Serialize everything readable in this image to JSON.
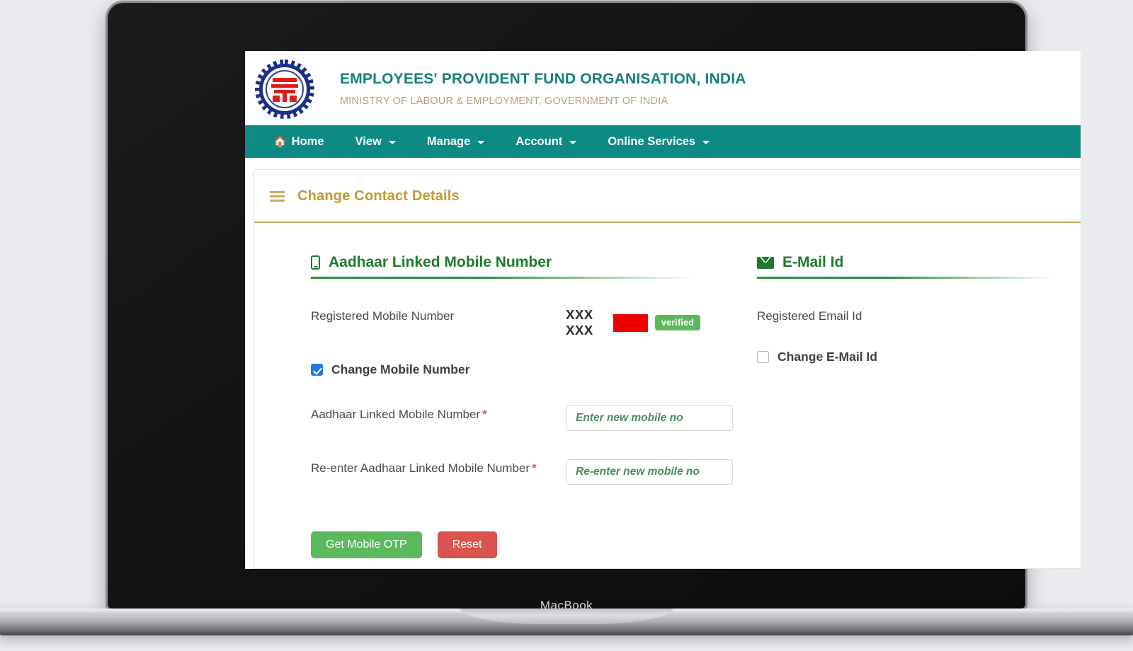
{
  "device": {
    "wordmark": "MacBook"
  },
  "site": {
    "logo_name": "epfo-emblem",
    "org_title": "EMPLOYEES' PROVIDENT FUND ORGANISATION, INDIA",
    "ministry_subtitle": "MINISTRY OF LABOUR & EMPLOYMENT, GOVERNMENT OF INDIA",
    "nav": [
      {
        "label": "Home",
        "icon": "home-icon",
        "has_caret": false
      },
      {
        "label": "View",
        "icon": "",
        "has_caret": true
      },
      {
        "label": "Manage",
        "icon": "",
        "has_caret": true
      },
      {
        "label": "Account",
        "icon": "",
        "has_caret": true
      },
      {
        "label": "Online Services",
        "icon": "",
        "has_caret": true
      }
    ]
  },
  "card": {
    "menu_icon": "hamburger-icon",
    "title": "Change Contact Details"
  },
  "mobile_section": {
    "icon": "mobile-phone-icon",
    "heading": "Aadhaar Linked Mobile Number",
    "registered_label": "Registered Mobile Number",
    "registered_value": "XXX XXX",
    "redacted": true,
    "verified_badge": "verified",
    "change_checkbox_label": "Change Mobile Number",
    "change_checkbox_checked": true,
    "new_number_label": "Aadhaar Linked Mobile Number",
    "new_number_required": "*",
    "new_number_placeholder": "Enter new mobile no",
    "new_number_value": "",
    "reenter_label": "Re-enter Aadhaar Linked Mobile Number",
    "reenter_required": "*",
    "reenter_placeholder": "Re-enter new mobile no",
    "reenter_value": ""
  },
  "email_section": {
    "icon": "envelope-icon",
    "heading": "E-Mail Id",
    "registered_label": "Registered Email Id",
    "change_checkbox_label": "Change E-Mail Id",
    "change_checkbox_checked": false
  },
  "actions": {
    "get_otp_label": "Get Mobile OTP",
    "reset_label": "Reset"
  },
  "colors": {
    "nav_teal": "#0d8a84",
    "org_title_teal": "#17807a",
    "ministry_tan": "#b8a177",
    "card_title_gold": "#bf9a31",
    "card_rule_gold": "#c9a95e",
    "section_green": "#1d7a2e",
    "underline_green": "#2a9440",
    "verified_green": "#5cb85c",
    "reset_red": "#d9534f",
    "redaction_red": "#ef0000",
    "checkbox_blue": "#2278e6",
    "required_star_red": "#e2574c",
    "page_background": "#eaebef"
  }
}
